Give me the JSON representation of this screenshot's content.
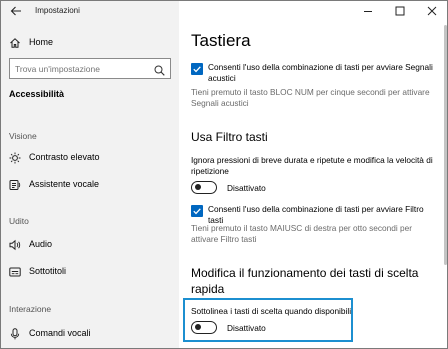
{
  "window": {
    "app_title": "Impostazioni",
    "colors": {
      "accent": "#0067c0",
      "highlight": "#1c8fd0",
      "sidebar_bg": "#f2f2f2"
    }
  },
  "sidebar": {
    "home": "Home",
    "search_placeholder": "Trova un'impostazione",
    "current_section": "Accessibilità",
    "groups": [
      {
        "title": "Visione",
        "items": [
          {
            "label": "Contrasto elevato",
            "icon": "brightness-icon"
          },
          {
            "label": "Assistente vocale",
            "icon": "narrator-icon"
          }
        ]
      },
      {
        "title": "Udito",
        "items": [
          {
            "label": "Audio",
            "icon": "speaker-icon"
          },
          {
            "label": "Sottotitoli",
            "icon": "captions-icon"
          }
        ]
      },
      {
        "title": "Interazione",
        "items": [
          {
            "label": "Comandi vocali",
            "icon": "microphone-icon"
          }
        ]
      }
    ]
  },
  "main": {
    "page_title": "Tastiera",
    "bloc_num": {
      "checkbox_label": "Consenti l'uso della combinazione di tasti per avviare Segnali acustici",
      "checked": true,
      "help": "Tieni premuto il tasto BLOC NUM per cinque secondi per attivare Segnali acustici"
    },
    "filter_keys": {
      "title": "Usa Filtro tasti",
      "description": "Ignora pressioni di breve durata e ripetute e modifica la velocità di ripetizione",
      "toggle_label": "Disattivato",
      "toggle_on": false,
      "checkbox_label": "Consenti l'uso della combinazione di tasti per avviare Filtro tasti",
      "checked": true,
      "help": "Tieni premuto il tasto MAIUSC di destra per otto secondi per attivare Filtro tasti"
    },
    "shortcut_keys": {
      "title": "Modifica il funzionamento dei tasti di scelta rapida",
      "option_label": "Sottolinea i tasti di scelta quando disponibili",
      "toggle_label": "Disattivato",
      "toggle_on": false
    }
  }
}
